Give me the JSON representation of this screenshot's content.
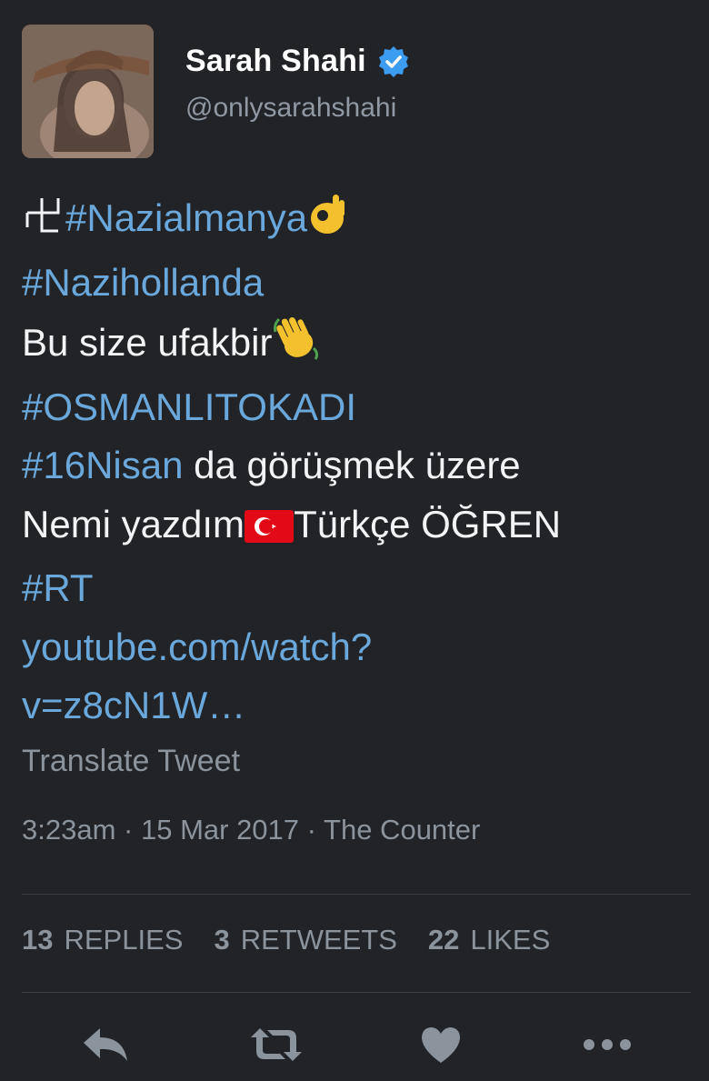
{
  "user": {
    "name": "Sarah Shahi",
    "handle": "@onlysarahshahi",
    "verified": true
  },
  "tweet": {
    "lines": [
      [
        {
          "t": "emoji",
          "v": "swastika-glyph"
        },
        {
          "t": "hashtag",
          "v": "#Nazialmanya"
        },
        {
          "t": "emoji",
          "v": "ok-hand-emoji"
        }
      ],
      [
        {
          "t": "hashtag",
          "v": "#Nazihollanda"
        }
      ],
      [
        {
          "t": "text",
          "v": "Bu size ufakbir"
        },
        {
          "t": "emoji",
          "v": "waving-hand-emoji"
        }
      ],
      [
        {
          "t": "hashtag",
          "v": "#OSMANLITOKADI"
        }
      ],
      [
        {
          "t": "hashtag",
          "v": "#16Nisan"
        },
        {
          "t": "text",
          "v": " da görüşmek üzere"
        }
      ],
      [
        {
          "t": "text",
          "v": "Nemi yazdım"
        },
        {
          "t": "emoji",
          "v": "turkey-flag-emoji"
        },
        {
          "t": "text",
          "v": "Türkçe ÖĞREN"
        }
      ],
      [
        {
          "t": "hashtag",
          "v": "#RT"
        }
      ],
      [
        {
          "t": "link",
          "v": "youtube.com/watch?"
        }
      ],
      [
        {
          "t": "link",
          "v": "v=z8cN1W…"
        }
      ]
    ]
  },
  "translate_label": "Translate Tweet",
  "meta": {
    "time": "3:23am",
    "sep1": " · ",
    "date": "15 Mar 2017",
    "sep2": " · ",
    "source": "The Counter"
  },
  "stats": {
    "replies_count": "13",
    "replies_label": "REPLIES",
    "retweets_count": "3",
    "retweets_label": "RETWEETS",
    "likes_count": "22",
    "likes_label": "LIKES"
  },
  "actions": [
    "reply-icon",
    "retweet-icon",
    "like-icon",
    "more-icon"
  ],
  "colors": {
    "background": "#222326",
    "link": "#6aa8dc",
    "muted": "#8b939c",
    "verified": "#3b9cf0"
  }
}
